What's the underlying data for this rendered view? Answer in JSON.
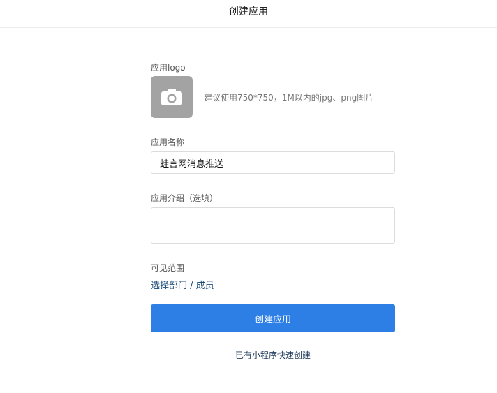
{
  "header": {
    "title": "创建应用"
  },
  "form": {
    "logo": {
      "label": "应用logo",
      "hint": "建议使用750*750，1M以内的jpg、png图片",
      "icon": "camera-icon"
    },
    "name": {
      "label": "应用名称",
      "value": "蛙言网消息推送"
    },
    "intro": {
      "label": "应用介绍（选填）",
      "value": ""
    },
    "visibility": {
      "label": "可见范围",
      "link": "选择部门 / 成员"
    },
    "submit_label": "创建应用",
    "quick_create_label": "已有小程序快速创建"
  },
  "colors": {
    "primary": "#2d7fe6",
    "link": "#1f4e79",
    "logo_placeholder": "#a3a3a3"
  }
}
